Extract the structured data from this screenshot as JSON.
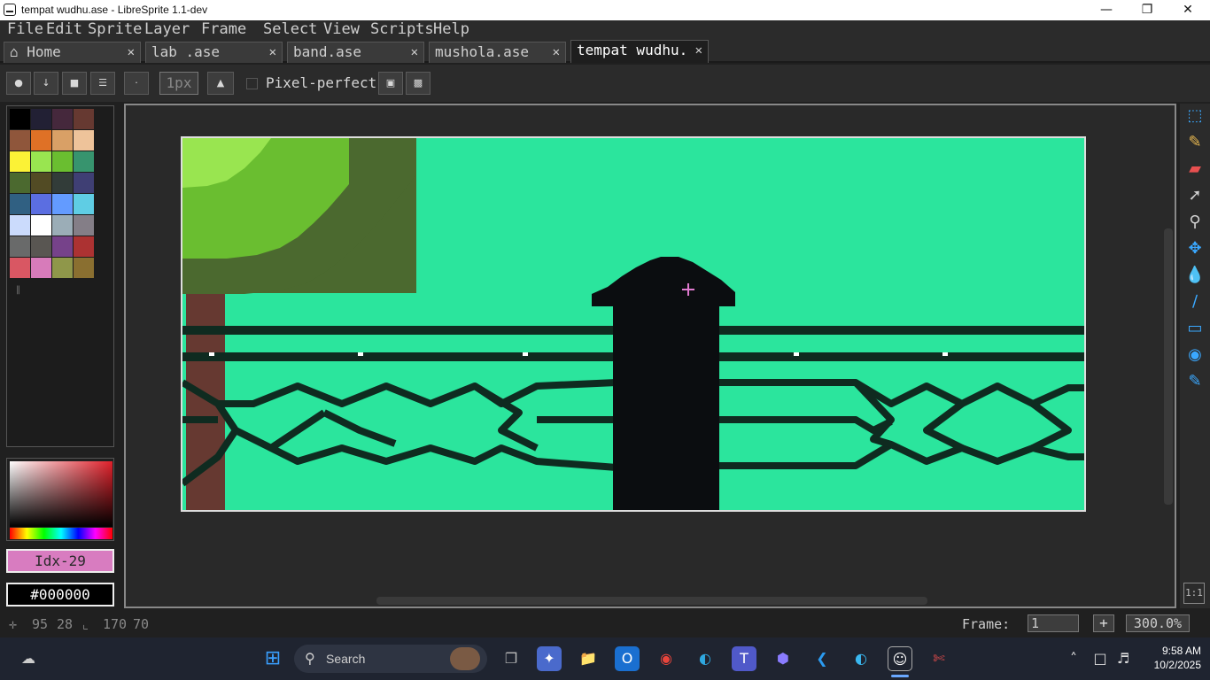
{
  "window": {
    "title": "tempat wudhu.ase - LibreSprite 1.1-dev",
    "minimize": "—",
    "maximize": "❐",
    "close": "✕"
  },
  "menu": [
    "File",
    "Edit",
    "Sprite",
    "Layer",
    "Frame",
    "Select",
    "View",
    "Scripts",
    "Help"
  ],
  "tabs": [
    {
      "label": "Home",
      "icon": "home-icon",
      "close": "✕"
    },
    {
      "label": "lab .ase",
      "close": "✕"
    },
    {
      "label": "band.ase",
      "close": "✕"
    },
    {
      "label": "mushola.ase",
      "close": "✕"
    },
    {
      "label": "tempat wudhu.",
      "close": "✕",
      "active": true
    }
  ],
  "context_bar": {
    "brush_size": "1px",
    "pixel_perfect_label": "Pixel-perfect",
    "pixel_perfect_checked": false
  },
  "palette": {
    "colors": [
      "#000000",
      "#222034",
      "#45283c",
      "#663931",
      "#8f563b",
      "#df7126",
      "#d9a066",
      "#eec39a",
      "#fbf236",
      "#99e550",
      "#6abe30",
      "#37946e",
      "#4b692f",
      "#524b24",
      "#323c39",
      "#3f3f74",
      "#306082",
      "#5b6ee1",
      "#639bff",
      "#5fcde4",
      "#cbdbfc",
      "#ffffff",
      "#9badb7",
      "#847e87",
      "#696a6a",
      "#595652",
      "#76428a",
      "#ac3232",
      "#d95763",
      "#d77bba",
      "#8f974a",
      "#8a6f30"
    ]
  },
  "color": {
    "index_label": "Idx-29",
    "hex": "#000000"
  },
  "status": {
    "cursor_x": "95",
    "cursor_y": "28",
    "size_w": "170",
    "size_h": "70",
    "frame_label": "Frame:",
    "frame_value": "1",
    "add_frame": "+",
    "zoom": "300.0%"
  },
  "tools": [
    "marquee-icon",
    "pencil-icon",
    "eraser-icon",
    "eyedropper-icon",
    "zoom-icon",
    "move-icon",
    "paint-bucket-icon",
    "line-icon",
    "rectangle-icon",
    "contour-icon",
    "blur-icon"
  ],
  "one_to_one": "1:1",
  "taskbar": {
    "search_label": "Search",
    "time": "9:58 AM",
    "date": "10/2/2025"
  }
}
